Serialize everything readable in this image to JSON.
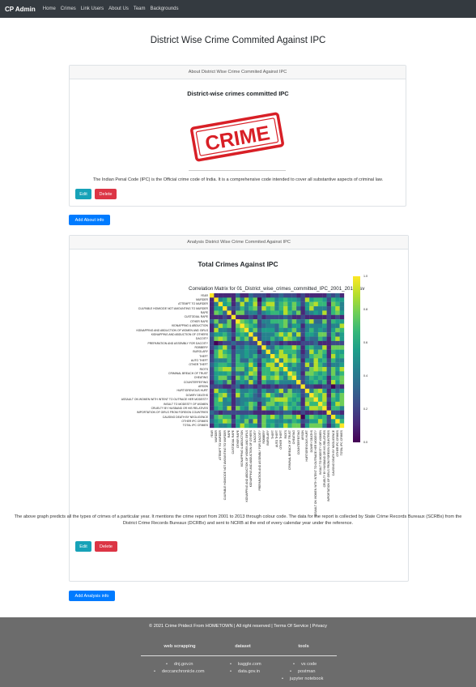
{
  "navbar": {
    "brand": "CP Admin",
    "links": [
      "Home",
      "Crimes",
      "Link Users",
      "About Us",
      "Team",
      "Backgrounds"
    ]
  },
  "page_title": "District Wise Crime Commited Against IPC",
  "about_card": {
    "header": "About District Wise Crime Commited Against IPC",
    "title": "District-wise crimes committed IPC",
    "stamp_text": "CRIME",
    "text": "The Indian Penal Code (IPC) is the Official crime code of India. It is a comprehensive code intended to cover all substantive aspects of criminal law.",
    "edit_label": "Edit",
    "delete_label": "Delete"
  },
  "add_about_label": "Add About info",
  "analysis_card": {
    "header": "Analysis District Wise Crime Commited Against IPC",
    "title": "Total Crimes Against IPC",
    "text": "The above graph predicts all the types of crimes of a particular year. It mentions the crime report from 2001 to 2013 through colour code. The data for the report is collected by State Crime Records Bureaux (SCRBx) from the District Crime Records Bureaux (DCRBx) and sent to NCRB at the end of every calendar year under the reference.",
    "edit_label": "Edit",
    "delete_label": "Delete"
  },
  "add_analysis_label": "Add Analysis info",
  "colors": {
    "navbar": "#343a40",
    "edit": "#17a2b8",
    "delete": "#dc3545",
    "primary": "#007bff",
    "footer": "#6c6c6c"
  },
  "chart_data": {
    "type": "heatmap",
    "title": "Correlation Matrix for 01_District_wise_crimes_committed_IPC_2001_2012.csv",
    "labels": [
      "YEAR",
      "MURDER",
      "ATTEMPT TO MURDER",
      "CULPABLE HOMICIDE NOT AMOUNTING TO MURDER",
      "RAPE",
      "CUSTODIAL RAPE",
      "OTHER RAPE",
      "KIDNAPPING & ABDUCTION",
      "KIDNAPPING AND ABDUCTION OF WOMEN AND GIRLS",
      "KIDNAPPING AND ABDUCTION OF OTHERS",
      "DACOITY",
      "PREPARATION AND ASSEMBLY FOR DACOITY",
      "ROBBERY",
      "BURGLARY",
      "THEFT",
      "AUTO THEFT",
      "OTHER THEFT",
      "RIOTS",
      "CRIMINAL BREACH OF TRUST",
      "CHEATING",
      "COUNTERFEITING",
      "ARSON",
      "HURT/GREVIOUS HURT",
      "DOWRY DEATHS",
      "ASSAULT ON WOMEN WITH INTENT TO OUTRAGE HER MODESTY",
      "INSULT TO MODESTY OF WOMEN",
      "CRUELTY BY HUSBAND OR HIS RELATIVES",
      "IMPORTATION OF GIRLS FROM FOREIGN COUNTRIES",
      "CAUSING DEATH BY NEGLIGENCE",
      "OTHER IPC CRIMES",
      "TOTAL IPC CRIMES"
    ],
    "colorbar_ticks": [
      "1.0",
      "0.8",
      "0.6",
      "0.4",
      "0.2",
      "0.0"
    ],
    "vmin": 0.0,
    "vmax": 1.0,
    "colormap": "viridis"
  },
  "footer": {
    "copyright": "© 2021 Crime Pridect From HOMETOWN | All right reserved | Terms Of Service | Privacy",
    "columns": [
      {
        "heading": "web scrapping",
        "items": [
          "dnj.gov.in",
          "deccanchronicle.com"
        ]
      },
      {
        "heading": "dataset",
        "items": [
          "kaggle.com",
          "data.gov.in"
        ]
      },
      {
        "heading": "tools",
        "items": [
          "vs code",
          "postman",
          "jupyter notebook"
        ]
      }
    ]
  }
}
